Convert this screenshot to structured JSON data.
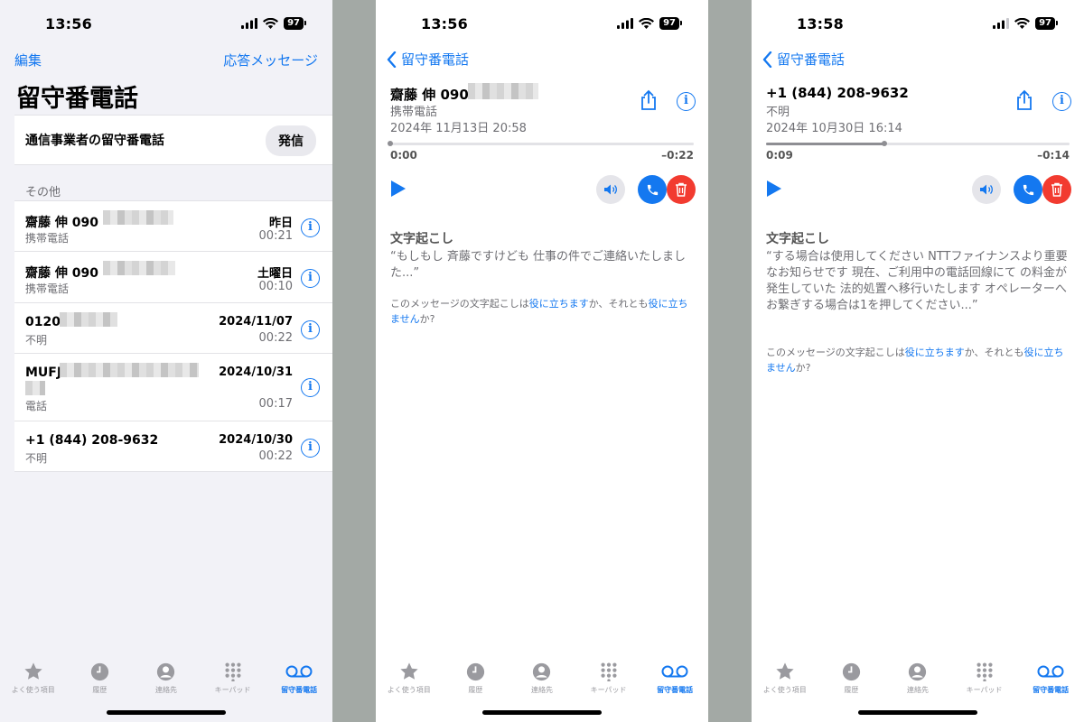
{
  "status": {
    "time1": "13:56",
    "time2": "13:56",
    "time3": "13:58",
    "battery": "97"
  },
  "list": {
    "edit": "編集",
    "greeting": "応答メッセージ",
    "title": "留守番電話",
    "carrier_label": "通信事業者の留守番電話",
    "call_button": "発信",
    "section": "その他",
    "items": [
      {
        "name": "齋藤 伸 090",
        "sub": "携帯電話",
        "date": "昨日",
        "dur": "00:21"
      },
      {
        "name": "齋藤 伸 090",
        "sub": "携帯電話",
        "date": "土曜日",
        "dur": "00:10"
      },
      {
        "name": "0120",
        "sub": "不明",
        "date": "2024/11/07",
        "dur": "00:22"
      },
      {
        "name": "MUFJ",
        "sub": "電話",
        "date": "2024/10/31",
        "dur": "00:17"
      },
      {
        "name": "+1 (844) 208-9632",
        "sub": "不明",
        "date": "2024/10/30",
        "dur": "00:22"
      }
    ]
  },
  "detail1": {
    "back": "留守番電話",
    "name": "齋藤 伸 090",
    "type": "携帯電話",
    "datetime": "2024年 11月13日 20:58",
    "elapsed": "0:00",
    "remaining": "–0:22",
    "progress": 0,
    "transcript_heading": "文字起こし",
    "transcript": "“もしもし 斉藤ですけども 仕事の件でご連絡いたしました...”"
  },
  "detail2": {
    "back": "留守番電話",
    "name": "+1 (844) 208-9632",
    "type": "不明",
    "datetime": "2024年 10月30日 16:14",
    "elapsed": "0:09",
    "remaining": "–0:14",
    "progress": 0.39,
    "transcript_heading": "文字起こし",
    "transcript": "“する場合は使用してください NTTファイナンスより重要なお知らせです 現在、ご利用中の電話回線にて の料金が発生していた 法的処置へ移行いたします オペレーターへお繋ぎする場合は1を押してください...”"
  },
  "feedback": {
    "pre": "このメッセージの文字起こしは",
    "helpful": "役に立ちます",
    "mid": "か、それとも",
    "not_helpful": "役に立ちません",
    "post": "か?"
  },
  "tabs": [
    {
      "label": "よく使う項目",
      "icon": "star-icon"
    },
    {
      "label": "履歴",
      "icon": "clock-icon"
    },
    {
      "label": "連絡先",
      "icon": "person-icon"
    },
    {
      "label": "キーパッド",
      "icon": "keypad-icon"
    },
    {
      "label": "留守番電話",
      "icon": "voicemail-icon"
    }
  ],
  "colors": {
    "accent": "#1478f0",
    "delete": "#f23b30",
    "background": "#f2f2f7"
  }
}
